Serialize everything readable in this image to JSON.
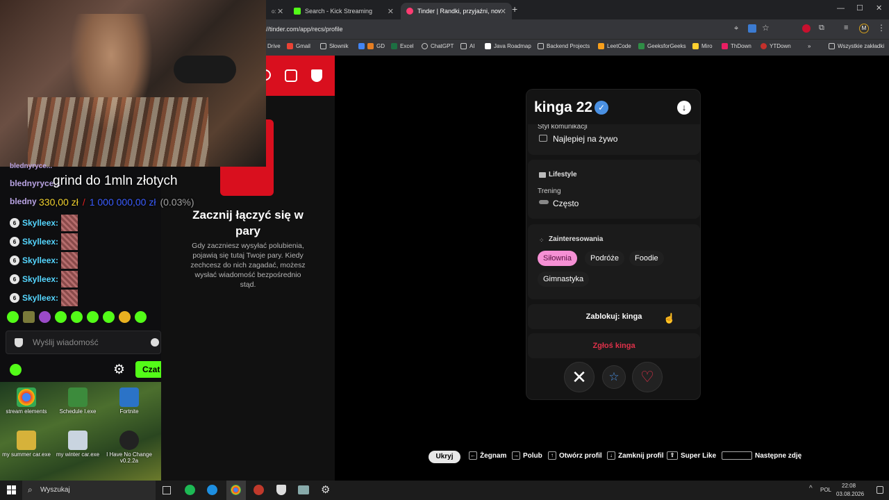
{
  "browser": {
    "tabs": [
      {
        "label": "Search - Kick Streaming",
        "color": "#53fc18"
      },
      {
        "label": "Tinder | Randki, przyjaźni, nowe",
        "color": "#fe3c72"
      }
    ],
    "url": "//tinder.com/app/recs/profile",
    "bookmarks": [
      "Drive",
      "Gmail",
      "Słownik",
      "GD",
      "Excel",
      "ChatGPT",
      "AI",
      "Java Roadmap",
      "Backend Projects",
      "LeetCode",
      "GeeksforGeeks",
      "Miro",
      "ThDown",
      "YTDown"
    ],
    "bookmarks_more": "»",
    "all_bookmarks": "Wszystkie zakładki"
  },
  "stream": {
    "goal_text": "grind do 1mln złotych",
    "goal_current": "330,00 zł",
    "goal_separator": "/",
    "goal_target": "1 000 000,00 zł",
    "goal_percent": "(0.03%)",
    "chat_lines": [
      {
        "user": "blednyryce...",
        "color": "#b9a3e3"
      },
      {
        "user": "blednyryce...",
        "color": "#b9a3e3"
      },
      {
        "user": "bledny",
        "color": "#b9a3e3"
      },
      {
        "user": "Skylleex:",
        "color": "#55d6ff"
      },
      {
        "user": "Skylleex:",
        "color": "#55d6ff"
      },
      {
        "user": "Skylleex:",
        "color": "#55d6ff"
      },
      {
        "user": "Skylleex:",
        "color": "#55d6ff"
      },
      {
        "user": "Skylleex:",
        "color": "#55d6ff"
      }
    ],
    "badge_number": "6",
    "message_placeholder": "Wyślij wiadomość",
    "chat_button": "Czat"
  },
  "desktop_icons": [
    {
      "label": "stream elements"
    },
    {
      "label": "Schedule I.exe"
    },
    {
      "label": "Fortnite"
    },
    {
      "label": "my summer car.exe"
    },
    {
      "label": "my winter car.exe"
    },
    {
      "label": "I Have No Change v0.2.2a"
    }
  ],
  "taskbar": {
    "search_placeholder": "Wyszukaj",
    "lang": "POL",
    "time": "22:08",
    "date": "03.08.2026"
  },
  "tinder": {
    "matches_title": "Zacznij łączyć się w pary",
    "matches_desc": "Gdy zaczniesz wysyłać polubienia, pojawią się tutaj Twoje pary. Kiedy zechcesz do nich zagadać, możesz wysłać wiadomość bezpośrednio stąd.",
    "profile_name": "kinga 22",
    "comm_label": "Styl komunikacji",
    "comm_value": "Najlepiej na żywo",
    "lifestyle_title": "Lifestyle",
    "training_label": "Trening",
    "training_value": "Często",
    "interests_title": "Zainteresowania",
    "interests": [
      "Siłownia",
      "Podróże",
      "Foodie",
      "Gimnastyka"
    ],
    "block_label": "Zablokuj: kinga",
    "report_label": "Zgłoś kinga",
    "shortcuts": [
      {
        "label": "Ukryj"
      },
      {
        "label": "Żegnam"
      },
      {
        "label": "Polub"
      },
      {
        "label": "Otwórz profil"
      },
      {
        "label": "Zamknij profil"
      },
      {
        "label": "Super Like"
      },
      {
        "label": "Następne zdję"
      }
    ],
    "accent": "#fe3c72",
    "report_color": "#e0314a"
  }
}
